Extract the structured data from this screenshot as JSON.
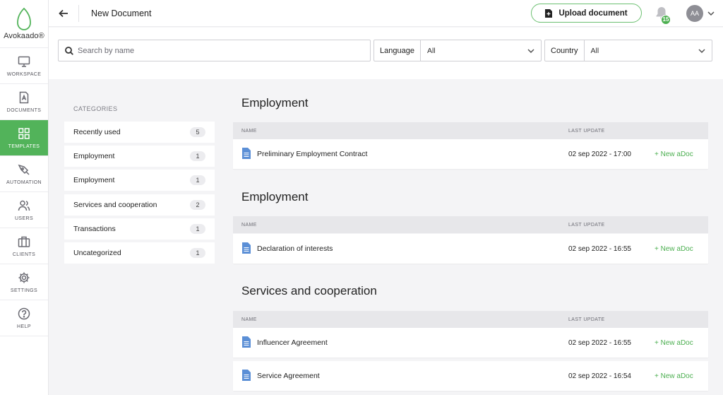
{
  "app": {
    "logo_text": "Avokaado®"
  },
  "sidebar": {
    "items": [
      {
        "label": "WORKSPACE",
        "icon": "monitor-icon"
      },
      {
        "label": "DOCUMENTS",
        "icon": "document-icon"
      },
      {
        "label": "TEMPLATES",
        "icon": "grid-icon",
        "active": true
      },
      {
        "label": "AUTOMATION",
        "icon": "pen-icon"
      },
      {
        "label": "USERS",
        "icon": "users-icon"
      },
      {
        "label": "CLIENTS",
        "icon": "briefcase-icon"
      },
      {
        "label": "SETTINGS",
        "icon": "gear-icon"
      },
      {
        "label": "HELP",
        "icon": "help-icon"
      }
    ]
  },
  "header": {
    "title": "New Document",
    "upload_label": "Upload document",
    "notification_count": "15",
    "avatar_initials": "AA"
  },
  "filters": {
    "search_placeholder": "Search by name",
    "language_label": "Language",
    "language_value": "All",
    "country_label": "Country",
    "country_value": "All"
  },
  "categories": {
    "heading": "CATEGORIES",
    "items": [
      {
        "label": "Recently used",
        "count": "5"
      },
      {
        "label": "Employment",
        "count": "1"
      },
      {
        "label": "Employment",
        "count": "1"
      },
      {
        "label": "Services and cooperation",
        "count": "2"
      },
      {
        "label": "Transactions",
        "count": "1"
      },
      {
        "label": "Uncategorized",
        "count": "1"
      }
    ]
  },
  "table_headers": {
    "name": "NAME",
    "last_update": "LAST UPDATE"
  },
  "sections": [
    {
      "title": "Employment",
      "docs": [
        {
          "name": "Preliminary Employment Contract",
          "date": "02 sep 2022 - 17:00",
          "action": "+ New aDoc"
        }
      ]
    },
    {
      "title": "Employment",
      "docs": [
        {
          "name": "Declaration of interests",
          "date": "02 sep 2022 - 16:55",
          "action": "+ New aDoc"
        }
      ]
    },
    {
      "title": "Services and cooperation",
      "docs": [
        {
          "name": "Influencer Agreement",
          "date": "02 sep 2022 - 16:55",
          "action": "+ New aDoc"
        },
        {
          "name": "Service Agreement",
          "date": "02 sep 2022 - 16:54",
          "action": "+ New aDoc"
        }
      ]
    }
  ],
  "colors": {
    "brand_green": "#52b35a",
    "link_green": "#4caf50",
    "doc_icon_blue": "#5b8fd6"
  }
}
